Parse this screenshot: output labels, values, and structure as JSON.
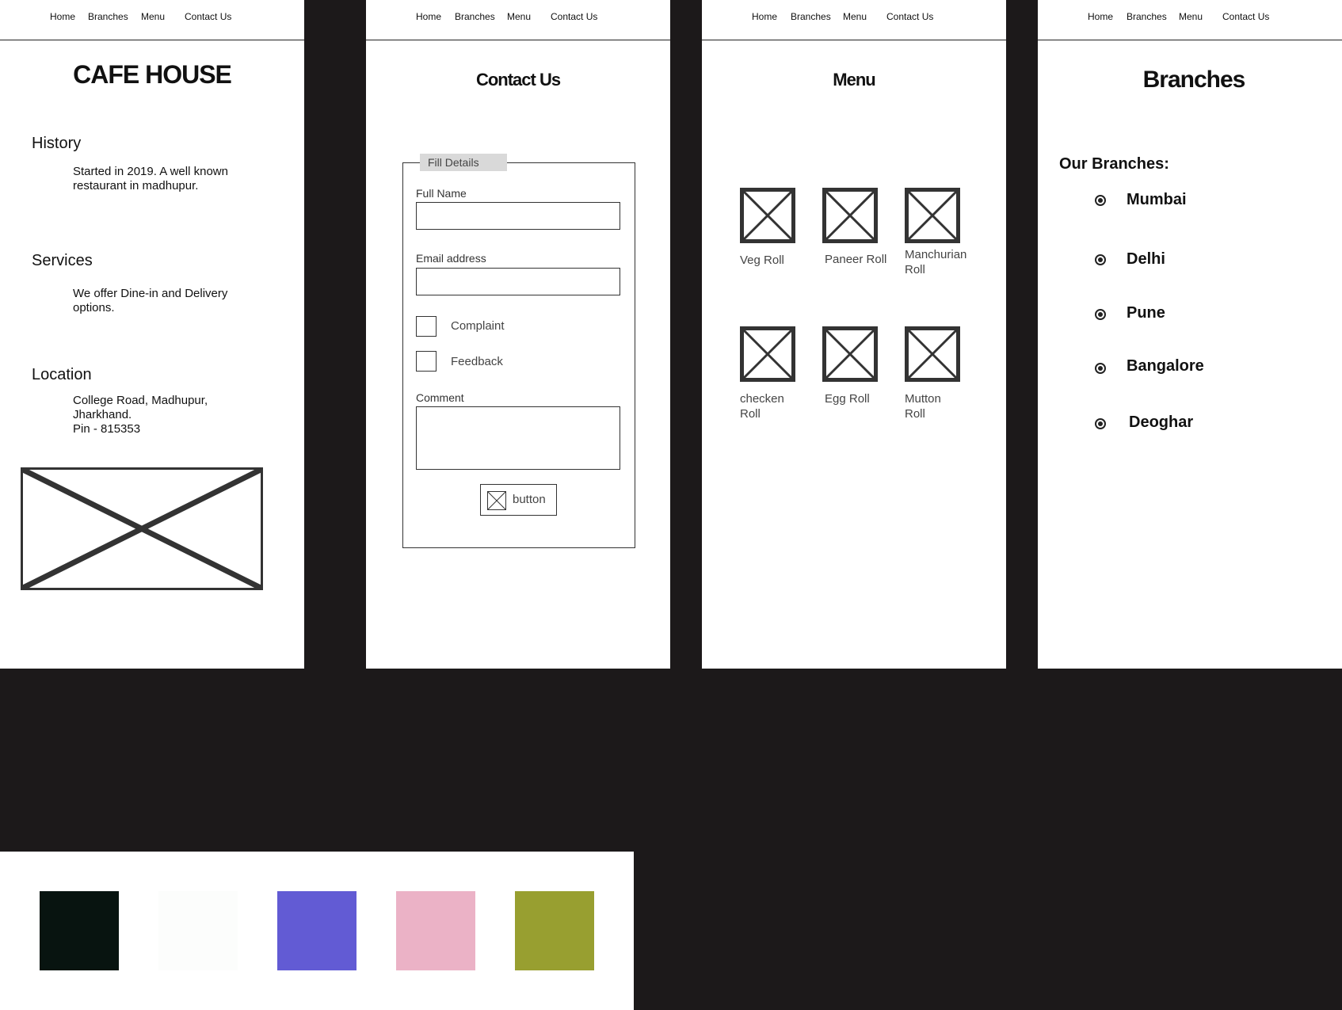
{
  "nav": [
    "Home",
    "Branches",
    "Menu",
    "Contact Us"
  ],
  "home": {
    "title": "CAFE HOUSE",
    "sections": [
      {
        "heading": "History",
        "text": "Started in 2019. A well known\nrestaurant in madhupur."
      },
      {
        "heading": "Services",
        "text": "We offer Dine-in and Delivery\noptions."
      },
      {
        "heading": "Location",
        "text": "College Road, Madhupur,\nJharkhand.\nPin - 815353"
      }
    ]
  },
  "contact": {
    "title": "Contact Us",
    "legend": "Fill Details",
    "full_name_label": "Full Name",
    "email_label": "Email address",
    "checkbox_complaint": "Complaint",
    "checkbox_feedback": "Feedback",
    "comment_label": "Comment",
    "button_label": "button"
  },
  "menu": {
    "title": "Menu",
    "items": [
      "Veg Roll",
      "Paneer Roll",
      "Manchurian\nRoll",
      "checken\nRoll",
      "Egg Roll",
      "Mutton\nRoll"
    ]
  },
  "branches": {
    "title": "Branches",
    "subtitle": "Our Branches:",
    "items": [
      "Mumbai",
      "Delhi",
      "Pune",
      "Bangalore",
      "Deoghar"
    ]
  },
  "palette": [
    "#081410",
    "#fcfdfc",
    "#625bd4",
    "#ebb2c6",
    "#989f30"
  ]
}
